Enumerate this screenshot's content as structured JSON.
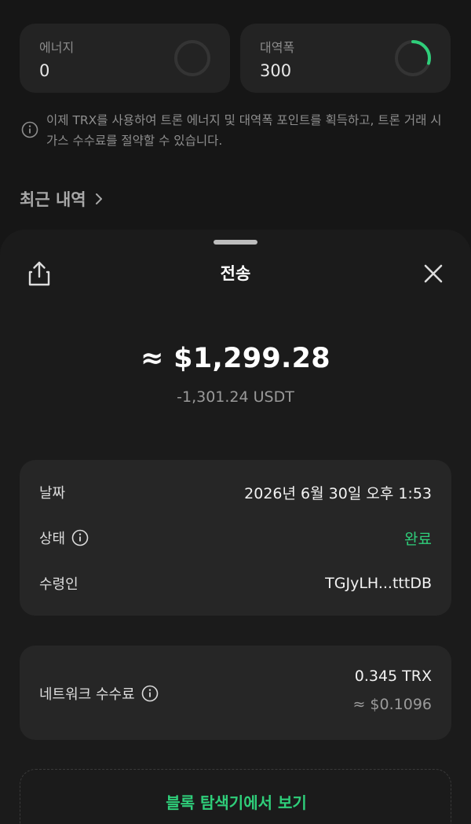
{
  "resources": {
    "energy": {
      "label": "에너지",
      "value": "0",
      "progress": 0
    },
    "bandwidth": {
      "label": "대역폭",
      "value": "300",
      "progress": 0.3
    }
  },
  "info_note": "이제 TRX를 사용하여 트론 에너지 및 대역폭 포인트를 획득하고, 트론 거래 시 가스 수수료를 절약할 수 있습니다.",
  "recent_history": {
    "title": "최근 내역"
  },
  "sheet": {
    "title": "전송",
    "amount_usd": "≈ $1,299.28",
    "amount_token": "-1,301.24 USDT",
    "details": {
      "date_label": "날짜",
      "date_value": "2026년 6월 30일 오후 1:53",
      "status_label": "상태",
      "status_value": "완료",
      "recipient_label": "수령인",
      "recipient_value": "TGJyLH...tttDB"
    },
    "fee": {
      "label": "네트워크 수수료",
      "trx": "0.345 TRX",
      "usd": "≈ $0.1096"
    },
    "explorer_label": "블록 탐색기에서 보기"
  },
  "colors": {
    "accent_green": "#2fce7a",
    "sheet_bg": "#1b1b1b",
    "card_bg": "#262626"
  },
  "icons": [
    "share-icon",
    "close-icon",
    "info-icon",
    "chevron-right-icon"
  ]
}
